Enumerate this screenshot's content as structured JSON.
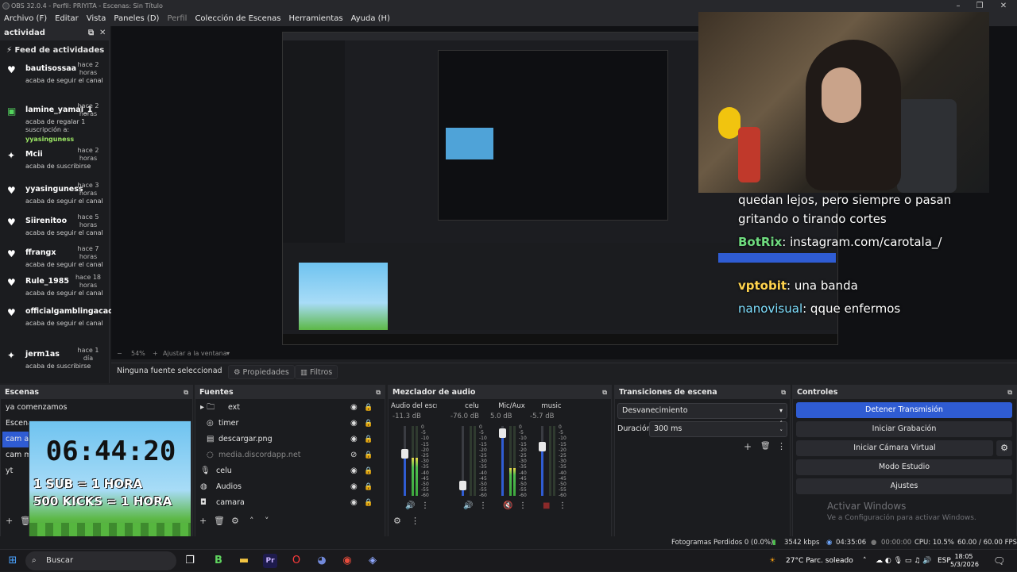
{
  "window": {
    "title": "OBS 32.0.4 - Perfil: PRIYITA - Escenas: Sin Título"
  },
  "menu": [
    "Archivo (F)",
    "Editar",
    "Vista",
    "Paneles (D)",
    "Perfil",
    "Colección de Escenas",
    "Herramientas",
    "Ayuda (H)"
  ],
  "activity": {
    "dock_title": "actividad",
    "feed_title": "Feed de actividades",
    "items": [
      {
        "icon": "heart-icon",
        "glyph": "♥",
        "name": "bautisossaa",
        "time": "hace 2 horas",
        "msg": "acaba de seguir el canal"
      },
      {
        "icon": "gift-icon",
        "glyph": "▣",
        "name": "lamine_yamal_1",
        "time": "hace 2 horas",
        "msg": "acaba de regalar 1 suscripción a:",
        "extra": "yyasinguness"
      },
      {
        "icon": "star-icon",
        "glyph": "✦",
        "name": "Mcii",
        "time": "hace 2 horas",
        "msg": "acaba de suscribirse"
      },
      {
        "icon": "heart-icon",
        "glyph": "♥",
        "name": "yyasinguness",
        "time": "hace 3 horas",
        "msg": "acaba de seguir el canal"
      },
      {
        "icon": "heart-icon",
        "glyph": "♥",
        "name": "Siirenitoo",
        "time": "hace 5 horas",
        "msg": "acaba de seguir el canal"
      },
      {
        "icon": "heart-icon",
        "glyph": "♥",
        "name": "ffrangx",
        "time": "hace 7 horas",
        "msg": "acaba de seguir el canal"
      },
      {
        "icon": "heart-icon",
        "glyph": "♥",
        "name": "Rule_1985",
        "time": "hace 18 horas",
        "msg": "acaba de seguir el canal"
      },
      {
        "icon": "heart-icon",
        "glyph": "♥",
        "name": "officialgamblingacad",
        "time": "",
        "msg": "acaba de seguir el canal"
      },
      {
        "icon": "star-icon",
        "glyph": "✦",
        "name": "jerm1as",
        "time": "hace 1 día",
        "msg": "acaba de suscribirse"
      }
    ]
  },
  "chat": [
    {
      "user": "",
      "text": "quedan lejos, pero siempre o pasan"
    },
    {
      "user": "",
      "text": "gritando o tirando cortes"
    },
    {
      "user": "BotRix",
      "text": ": instagram.com/carotala_/"
    },
    {
      "user": "vptobit",
      "text": ": una banda"
    },
    {
      "user": "nanovisual",
      "text": ": qque enfermos"
    }
  ],
  "preview": {
    "zoom": "54%",
    "fit": "Ajustar a la ventana"
  },
  "source_toolbar": {
    "no_source": "Ninguna fuente seleccionad",
    "properties": "Propiedades",
    "filters": "Filtros"
  },
  "scenes": {
    "title": "Escenas",
    "items": [
      "ya comenzamos",
      "Escena",
      "cam ar",
      "cam m",
      "yt"
    ],
    "timer": {
      "clock": "06:44:20",
      "line1": "1 SUB = 1 HORA",
      "line2": "500 KICKS = 1 HORA"
    }
  },
  "sources": {
    "title": "Fuentes",
    "items": [
      {
        "name": "ext",
        "icon": "folder-icon",
        "glyph": "▸ 🗀",
        "indent": 0
      },
      {
        "name": "timer",
        "icon": "text-icon",
        "glyph": "◎",
        "indent": 1
      },
      {
        "name": "descargar.png",
        "icon": "image-icon",
        "glyph": "▤",
        "indent": 1
      },
      {
        "name": "media.discordapp.net",
        "icon": "browser-icon",
        "glyph": "◌",
        "indent": 1,
        "hidden": true
      },
      {
        "name": "celu",
        "icon": "mic-icon",
        "glyph": "🎙",
        "indent": 0
      },
      {
        "name": "Audios",
        "icon": "audio-icon",
        "glyph": "◍",
        "indent": 0
      },
      {
        "name": "camara",
        "icon": "camera-icon",
        "glyph": "◘",
        "indent": 0
      }
    ]
  },
  "mixer": {
    "title": "Mezclador de audio",
    "channels": [
      {
        "name": "Audio del escritorio",
        "db": "-11.3 dB",
        "level": 0.55,
        "fader": 0.6,
        "muted": false
      },
      {
        "name": "celu",
        "db": "-76.0 dB",
        "level": 0.0,
        "fader": 0.15,
        "muted": false
      },
      {
        "name": "Mic/Aux",
        "db": "5.0 dB",
        "level": 0.4,
        "fader": 0.9,
        "muted": true
      },
      {
        "name": "music",
        "db": "-5.7 dB",
        "level": 0.0,
        "fader": 0.7,
        "muted": true
      }
    ],
    "scale": [
      "0",
      "-5",
      "-10",
      "-15",
      "-20",
      "-25",
      "-30",
      "-35",
      "-40",
      "-45",
      "-50",
      "-55",
      "-60"
    ]
  },
  "transitions": {
    "title": "Transiciones de escena",
    "selected": "Desvanecimiento",
    "duration_label": "Duración",
    "duration": "300 ms"
  },
  "controls": {
    "title": "Controles",
    "buttons": [
      "Detener Transmisión",
      "Iniciar Grabación",
      "Iniciar Cámara Virtual",
      "Modo Estudio",
      "Ajustes"
    ]
  },
  "watermark": {
    "line1": "Activar Windows",
    "line2": "Ve a Configuración para activar Windows."
  },
  "status": {
    "dropped": "Fotogramas Perdidos 0 (0.0%)",
    "bitrate": "3542 kbps",
    "stream_time": "04:35:06",
    "rec_time": "00:00:00",
    "cpu": "CPU: 10.5%",
    "fps": "60.00 / 60.00 FPS"
  },
  "taskbar": {
    "search": "Buscar",
    "weather": "27°C  Parc. soleado",
    "lang": "ESP",
    "time": "18:05",
    "date": "5/3/2026"
  },
  "colors": {
    "accent": "#2f5cd3",
    "panel": "#1b1c1f"
  }
}
